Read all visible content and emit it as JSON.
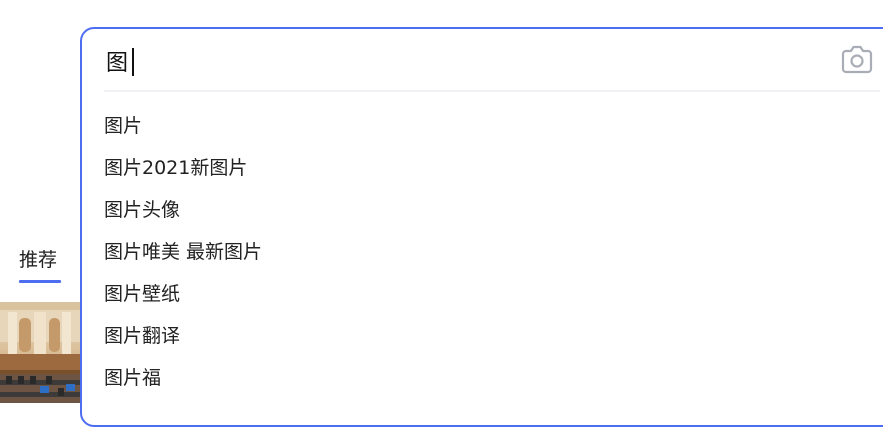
{
  "tabs": {
    "recommend_label": "推荐",
    "accent_color": "#4e6ef2"
  },
  "search": {
    "query": "图",
    "camera_icon": "camera-icon",
    "border_color": "#4e6ef2"
  },
  "suggestions": [
    "图片",
    "图片2021新图片",
    "图片头像",
    "图片唯美 最新图片",
    "图片壁纸",
    "图片翻译",
    "图片福"
  ]
}
